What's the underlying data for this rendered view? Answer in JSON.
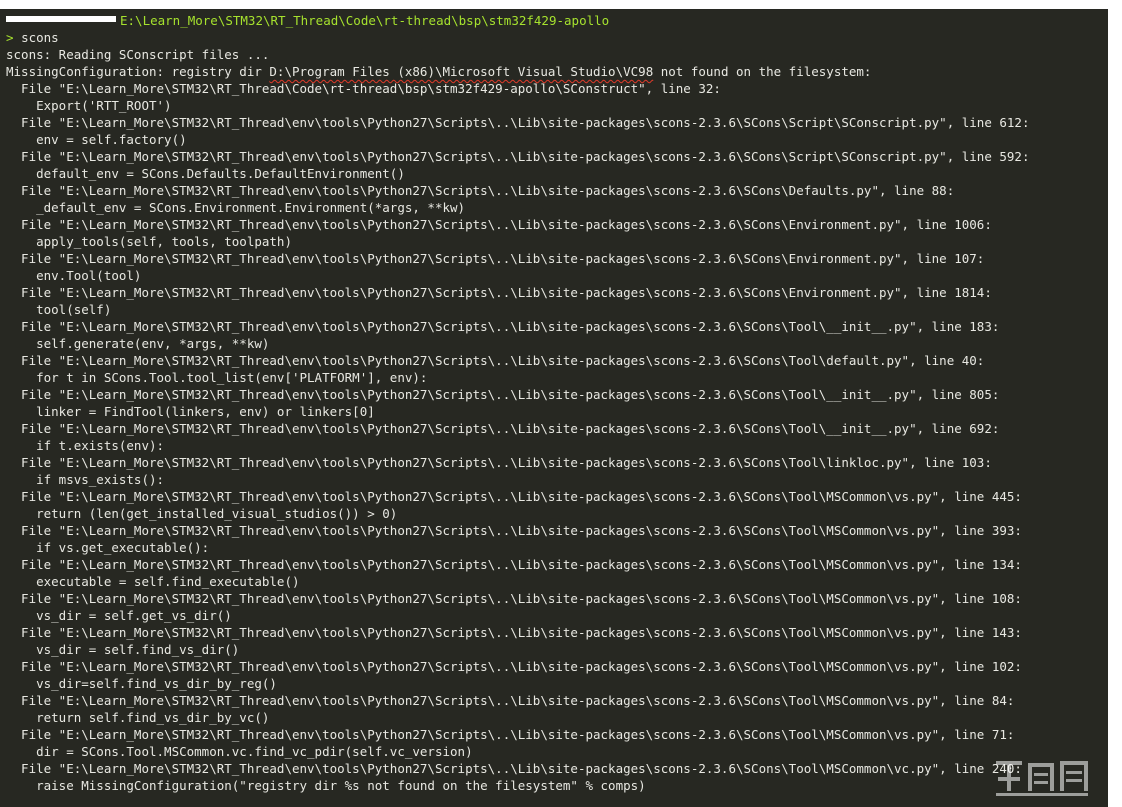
{
  "prompt": {
    "path": "E:\\Learn_More\\STM32\\RT_Thread\\Code\\rt-thread\\bsp\\stm32f429-apollo",
    "symbol": ">",
    "command": "scons"
  },
  "status": {
    "reading": "scons: Reading SConscript files ...",
    "error_prefix": "MissingConfiguration: registry dir ",
    "error_path": "D:\\Program Files (x86)\\Microsoft Visual Studio\\VC98",
    "error_suffix": " not found on the filesystem:"
  },
  "traceback": [
    {
      "file": "  File \"E:\\Learn_More\\STM32\\RT_Thread\\Code\\rt-thread\\bsp\\stm32f429-apollo\\SConstruct\", line 32:",
      "code": "    Export('RTT_ROOT')"
    },
    {
      "file": "  File \"E:\\Learn_More\\STM32\\RT_Thread\\env\\tools\\Python27\\Scripts\\..\\Lib\\site-packages\\scons-2.3.6\\SCons\\Script\\SConscript.py\", line 612:",
      "code": "    env = self.factory()"
    },
    {
      "file": "  File \"E:\\Learn_More\\STM32\\RT_Thread\\env\\tools\\Python27\\Scripts\\..\\Lib\\site-packages\\scons-2.3.6\\SCons\\Script\\SConscript.py\", line 592:",
      "code": "    default_env = SCons.Defaults.DefaultEnvironment()"
    },
    {
      "file": "  File \"E:\\Learn_More\\STM32\\RT_Thread\\env\\tools\\Python27\\Scripts\\..\\Lib\\site-packages\\scons-2.3.6\\SCons\\Defaults.py\", line 88:",
      "code": "    _default_env = SCons.Environment.Environment(*args, **kw)"
    },
    {
      "file": "  File \"E:\\Learn_More\\STM32\\RT_Thread\\env\\tools\\Python27\\Scripts\\..\\Lib\\site-packages\\scons-2.3.6\\SCons\\Environment.py\", line 1006:",
      "code": "    apply_tools(self, tools, toolpath)"
    },
    {
      "file": "  File \"E:\\Learn_More\\STM32\\RT_Thread\\env\\tools\\Python27\\Scripts\\..\\Lib\\site-packages\\scons-2.3.6\\SCons\\Environment.py\", line 107:",
      "code": "    env.Tool(tool)"
    },
    {
      "file": "  File \"E:\\Learn_More\\STM32\\RT_Thread\\env\\tools\\Python27\\Scripts\\..\\Lib\\site-packages\\scons-2.3.6\\SCons\\Environment.py\", line 1814:",
      "code": "    tool(self)"
    },
    {
      "file": "  File \"E:\\Learn_More\\STM32\\RT_Thread\\env\\tools\\Python27\\Scripts\\..\\Lib\\site-packages\\scons-2.3.6\\SCons\\Tool\\__init__.py\", line 183:",
      "code": "    self.generate(env, *args, **kw)"
    },
    {
      "file": "  File \"E:\\Learn_More\\STM32\\RT_Thread\\env\\tools\\Python27\\Scripts\\..\\Lib\\site-packages\\scons-2.3.6\\SCons\\Tool\\default.py\", line 40:",
      "code": "    for t in SCons.Tool.tool_list(env['PLATFORM'], env):"
    },
    {
      "file": "  File \"E:\\Learn_More\\STM32\\RT_Thread\\env\\tools\\Python27\\Scripts\\..\\Lib\\site-packages\\scons-2.3.6\\SCons\\Tool\\__init__.py\", line 805:",
      "code": "    linker = FindTool(linkers, env) or linkers[0]"
    },
    {
      "file": "  File \"E:\\Learn_More\\STM32\\RT_Thread\\env\\tools\\Python27\\Scripts\\..\\Lib\\site-packages\\scons-2.3.6\\SCons\\Tool\\__init__.py\", line 692:",
      "code": "    if t.exists(env):"
    },
    {
      "file": "  File \"E:\\Learn_More\\STM32\\RT_Thread\\env\\tools\\Python27\\Scripts\\..\\Lib\\site-packages\\scons-2.3.6\\SCons\\Tool\\linkloc.py\", line 103:",
      "code": "    if msvs_exists():"
    },
    {
      "file": "  File \"E:\\Learn_More\\STM32\\RT_Thread\\env\\tools\\Python27\\Scripts\\..\\Lib\\site-packages\\scons-2.3.6\\SCons\\Tool\\MSCommon\\vs.py\", line 445:",
      "code": "    return (len(get_installed_visual_studios()) > 0)"
    },
    {
      "file": "  File \"E:\\Learn_More\\STM32\\RT_Thread\\env\\tools\\Python27\\Scripts\\..\\Lib\\site-packages\\scons-2.3.6\\SCons\\Tool\\MSCommon\\vs.py\", line 393:",
      "code": "    if vs.get_executable():"
    },
    {
      "file": "  File \"E:\\Learn_More\\STM32\\RT_Thread\\env\\tools\\Python27\\Scripts\\..\\Lib\\site-packages\\scons-2.3.6\\SCons\\Tool\\MSCommon\\vs.py\", line 134:",
      "code": "    executable = self.find_executable()"
    },
    {
      "file": "  File \"E:\\Learn_More\\STM32\\RT_Thread\\env\\tools\\Python27\\Scripts\\..\\Lib\\site-packages\\scons-2.3.6\\SCons\\Tool\\MSCommon\\vs.py\", line 108:",
      "code": "    vs_dir = self.get_vs_dir()"
    },
    {
      "file": "  File \"E:\\Learn_More\\STM32\\RT_Thread\\env\\tools\\Python27\\Scripts\\..\\Lib\\site-packages\\scons-2.3.6\\SCons\\Tool\\MSCommon\\vs.py\", line 143:",
      "code": "    vs_dir = self.find_vs_dir()"
    },
    {
      "file": "  File \"E:\\Learn_More\\STM32\\RT_Thread\\env\\tools\\Python27\\Scripts\\..\\Lib\\site-packages\\scons-2.3.6\\SCons\\Tool\\MSCommon\\vs.py\", line 102:",
      "code": "    vs_dir=self.find_vs_dir_by_reg()"
    },
    {
      "file": "  File \"E:\\Learn_More\\STM32\\RT_Thread\\env\\tools\\Python27\\Scripts\\..\\Lib\\site-packages\\scons-2.3.6\\SCons\\Tool\\MSCommon\\vs.py\", line 84:",
      "code": "    return self.find_vs_dir_by_vc()"
    },
    {
      "file": "  File \"E:\\Learn_More\\STM32\\RT_Thread\\env\\tools\\Python27\\Scripts\\..\\Lib\\site-packages\\scons-2.3.6\\SCons\\Tool\\MSCommon\\vs.py\", line 71:",
      "code": "    dir = SCons.Tool.MSCommon.vc.find_vc_pdir(self.vc_version)"
    },
    {
      "file": "  File \"E:\\Learn_More\\STM32\\RT_Thread\\env\\tools\\Python27\\Scripts\\..\\Lib\\site-packages\\scons-2.3.6\\SCons\\Tool\\MSCommon\\vc.py\", line 240:",
      "code": "    raise MissingConfiguration(\"registry dir %s not found on the filesystem\" % comps)"
    }
  ],
  "colors": {
    "background": "#272822",
    "text": "#e8e8e2",
    "path": "#a6e22e",
    "underline": "#e03a2a"
  }
}
